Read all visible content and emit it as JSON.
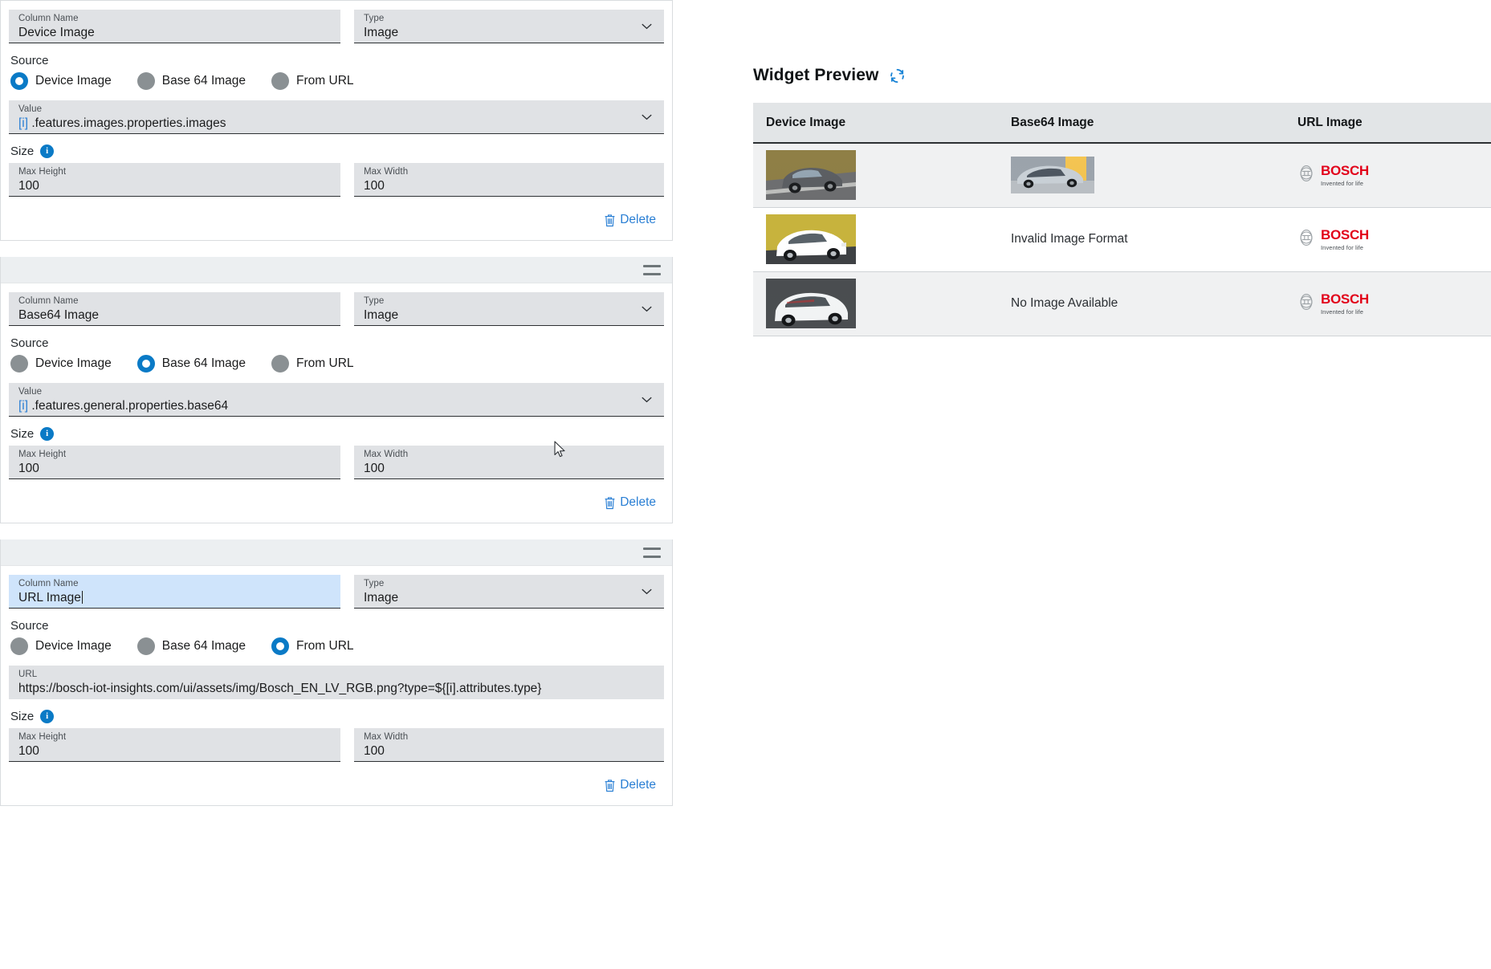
{
  "columns": [
    {
      "id": "device-image",
      "has_drag_handle": false,
      "column_name_label": "Column Name",
      "column_name_value": "Device Image",
      "column_name_focused": false,
      "type_label": "Type",
      "type_value": "Image",
      "source_label": "Source",
      "source_options": [
        "Device Image",
        "Base 64 Image",
        "From URL"
      ],
      "source_selected_index": 0,
      "detail_label": "Value",
      "detail_token": "[i]",
      "detail_value": ".features.images.properties.images",
      "detail_has_caret": true,
      "size_label": "Size",
      "size_info_icon": "info-icon",
      "max_height_label": "Max Height",
      "max_height_value": "100",
      "max_width_label": "Max Width",
      "max_width_value": "100",
      "delete_label": "Delete"
    },
    {
      "id": "base64-image",
      "has_drag_handle": true,
      "column_name_label": "Column Name",
      "column_name_value": "Base64 Image",
      "column_name_focused": false,
      "type_label": "Type",
      "type_value": "Image",
      "source_label": "Source",
      "source_options": [
        "Device Image",
        "Base 64 Image",
        "From URL"
      ],
      "source_selected_index": 1,
      "detail_label": "Value",
      "detail_token": "[i]",
      "detail_value": ".features.general.properties.base64",
      "detail_has_caret": true,
      "size_label": "Size",
      "size_info_icon": "info-icon",
      "max_height_label": "Max Height",
      "max_height_value": "100",
      "max_width_label": "Max Width",
      "max_width_value": "100",
      "delete_label": "Delete"
    },
    {
      "id": "url-image",
      "has_drag_handle": true,
      "column_name_label": "Column Name",
      "column_name_value": "URL Image",
      "column_name_focused": true,
      "type_label": "Type",
      "type_value": "Image",
      "source_label": "Source",
      "source_options": [
        "Device Image",
        "Base 64 Image",
        "From URL"
      ],
      "source_selected_index": 2,
      "detail_label": "URL",
      "detail_token": "",
      "detail_value": "https://bosch-iot-insights.com/ui/assets/img/Bosch_EN_LV_RGB.png?type=${[i].attributes.type}",
      "detail_has_caret": false,
      "size_label": "Size",
      "size_info_icon": "info-icon",
      "max_height_label": "Max Height",
      "max_height_value": "100",
      "max_width_label": "Max Width",
      "max_width_value": "100",
      "delete_label": "Delete"
    }
  ],
  "preview": {
    "title": "Widget Preview",
    "refresh_icon": "refresh-icon",
    "headers": [
      "Device Image",
      "Base64 Image",
      "URL Image"
    ],
    "rows": [
      {
        "device_image": "car-thumbnail-dark-sedan",
        "base64_cell_type": "image",
        "base64_image": "car-thumbnail-blue-concept",
        "base64_text": "",
        "url_image": "bosch-logo"
      },
      {
        "device_image": "car-thumbnail-white-sedan",
        "base64_cell_type": "text",
        "base64_image": "",
        "base64_text": "Invalid Image Format",
        "url_image": "bosch-logo"
      },
      {
        "device_image": "car-thumbnail-silver-wagon",
        "base64_cell_type": "text",
        "base64_image": "",
        "base64_text": "No Image Available",
        "url_image": "bosch-logo"
      }
    ],
    "bosch_logo": {
      "wordmark": "BOSCH",
      "tagline": "Invented for life"
    }
  },
  "colors": {
    "accent_blue": "#0a7ac6",
    "link_blue": "#2a7fd4",
    "bosch_red": "#e2001a",
    "field_bg": "#e0e2e5",
    "field_focus_bg": "#cfe4fb",
    "panel_header_bg": "#eceff1",
    "table_header_bg": "#e2e5e7",
    "row_shade_bg": "#f0f1f2"
  }
}
